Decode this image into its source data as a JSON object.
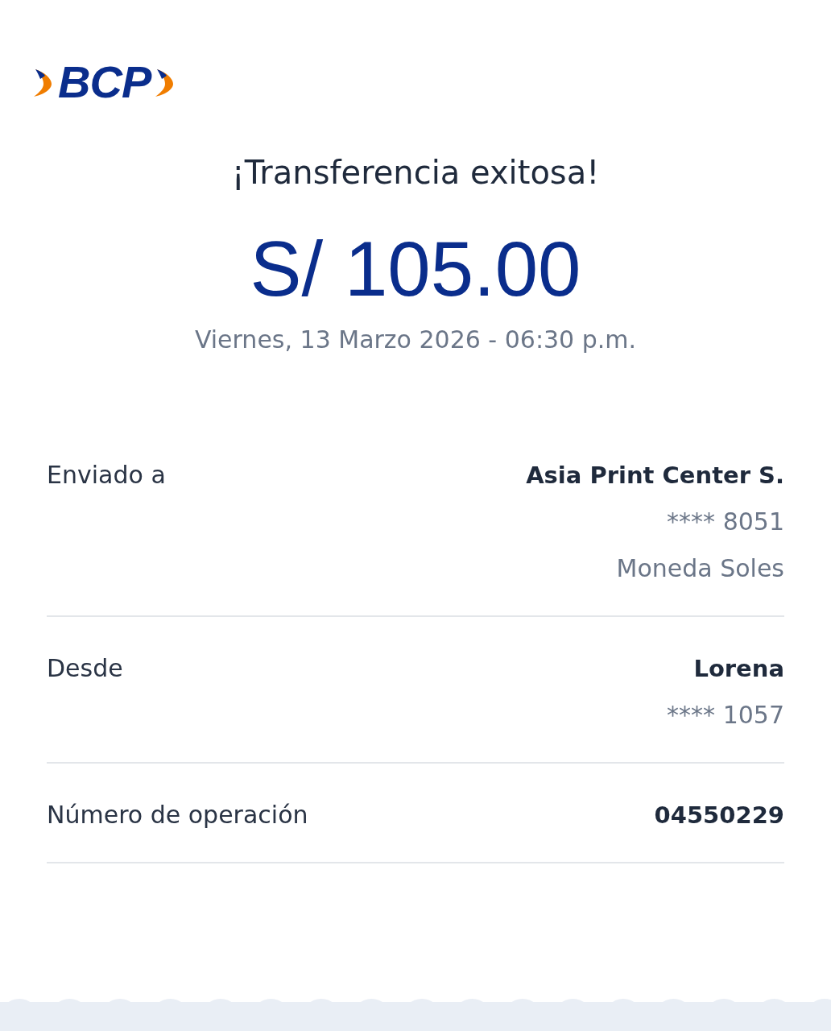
{
  "logo": {
    "text": "BCP"
  },
  "title": "¡Transferencia exitosa!",
  "amount": "S/ 105.00",
  "datetime": "Viernes, 13 Marzo 2026 - 06:30 p.m.",
  "details": [
    {
      "label": "Enviado a",
      "values": [
        {
          "text": "Asia Print Center S.",
          "kind": "primary"
        },
        {
          "text": "**** 8051",
          "kind": "secondary"
        },
        {
          "text": "Moneda Soles",
          "kind": "secondary"
        }
      ]
    },
    {
      "label": "Desde",
      "values": [
        {
          "text": "Lorena",
          "kind": "primary"
        },
        {
          "text": "**** 1057",
          "kind": "secondary"
        }
      ]
    },
    {
      "label": "Número de operación",
      "values": [
        {
          "text": "04550229",
          "kind": "primary"
        }
      ]
    }
  ]
}
